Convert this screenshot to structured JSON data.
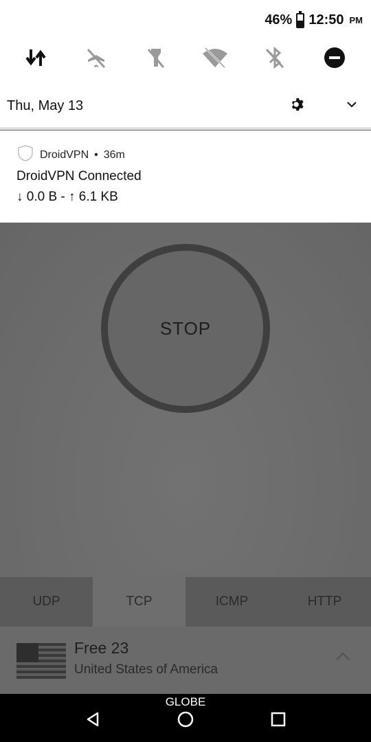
{
  "status_bar": {
    "battery": "46%",
    "battery_level": 0.46,
    "time": "12:50",
    "ampm": "PM"
  },
  "quick_settings": {
    "date": "Thu, May 13",
    "tiles": [
      "data-transfer-icon",
      "airplane-mode-off-icon",
      "flashlight-off-icon",
      "wifi-off-icon",
      "bluetooth-off-icon",
      "do-not-disturb-icon"
    ]
  },
  "notification": {
    "app": "DroidVPN",
    "age": "36m",
    "title": "DroidVPN Connected",
    "body": "↓ 0.0 B - ↑ 6.1 KB"
  },
  "app": {
    "stop_label": "STOP",
    "tabs": [
      {
        "label": "UDP",
        "active": false
      },
      {
        "label": "TCP",
        "active": true
      },
      {
        "label": "ICMP",
        "active": false
      },
      {
        "label": "HTTP",
        "active": false
      }
    ],
    "server": {
      "name": "Free 23",
      "country": "United States of America"
    }
  },
  "nav": {
    "carrier": "GLOBE"
  },
  "colors": {
    "app_bg": "#6e6e6e",
    "shade_bg": "#ffffff",
    "nav_bg": "#000000"
  }
}
